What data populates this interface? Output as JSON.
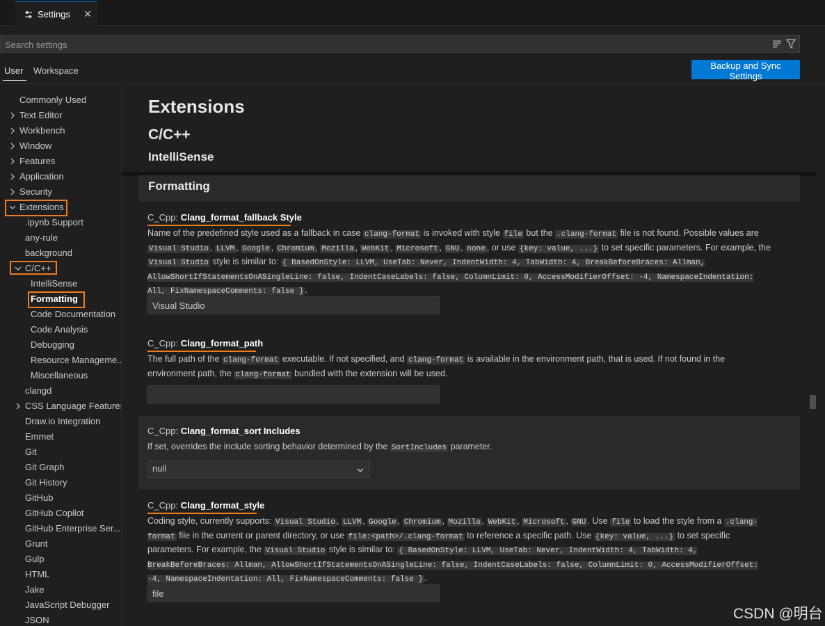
{
  "tab": {
    "icon": "settings-icon",
    "label": "Settings",
    "close": "✕"
  },
  "search": {
    "placeholder": "Search settings"
  },
  "scope": {
    "user": "User",
    "workspace": "Workspace",
    "backup_button": "Backup and Sync Settings"
  },
  "toc": [
    {
      "label": "Commonly Used",
      "indent": 0,
      "chevron": "none"
    },
    {
      "label": "Text Editor",
      "indent": 0,
      "chevron": "right"
    },
    {
      "label": "Workbench",
      "indent": 0,
      "chevron": "right"
    },
    {
      "label": "Window",
      "indent": 0,
      "chevron": "right"
    },
    {
      "label": "Features",
      "indent": 0,
      "chevron": "right"
    },
    {
      "label": "Application",
      "indent": 0,
      "chevron": "right"
    },
    {
      "label": "Security",
      "indent": 0,
      "chevron": "right"
    },
    {
      "label": "Extensions",
      "indent": 0,
      "chevron": "down",
      "highlight": true
    },
    {
      "label": ".ipynb Support",
      "indent": 1,
      "chevron": "none"
    },
    {
      "label": "any-rule",
      "indent": 1,
      "chevron": "none"
    },
    {
      "label": "background",
      "indent": 1,
      "chevron": "none"
    },
    {
      "label": "C/C++",
      "indent": 1,
      "chevron": "down",
      "highlight": true
    },
    {
      "label": "IntelliSense",
      "indent": 2,
      "chevron": "none"
    },
    {
      "label": "Formatting",
      "indent": 2,
      "chevron": "none",
      "highlight": true,
      "active": true
    },
    {
      "label": "Code Documentation",
      "indent": 2,
      "chevron": "none"
    },
    {
      "label": "Code Analysis",
      "indent": 2,
      "chevron": "none"
    },
    {
      "label": "Debugging",
      "indent": 2,
      "chevron": "none"
    },
    {
      "label": "Resource Manageme...",
      "indent": 2,
      "chevron": "none"
    },
    {
      "label": "Miscellaneous",
      "indent": 2,
      "chevron": "none"
    },
    {
      "label": "clangd",
      "indent": 1,
      "chevron": "none"
    },
    {
      "label": "CSS Language Features",
      "indent": 1,
      "chevron": "right"
    },
    {
      "label": "Draw.io Integration",
      "indent": 1,
      "chevron": "none"
    },
    {
      "label": "Emmet",
      "indent": 1,
      "chevron": "none"
    },
    {
      "label": "Git",
      "indent": 1,
      "chevron": "none"
    },
    {
      "label": "Git Graph",
      "indent": 1,
      "chevron": "none"
    },
    {
      "label": "Git History",
      "indent": 1,
      "chevron": "none"
    },
    {
      "label": "GitHub",
      "indent": 1,
      "chevron": "none"
    },
    {
      "label": "GitHub Copilot",
      "indent": 1,
      "chevron": "none"
    },
    {
      "label": "GitHub Enterprise Ser...",
      "indent": 1,
      "chevron": "none"
    },
    {
      "label": "Grunt",
      "indent": 1,
      "chevron": "none"
    },
    {
      "label": "Gulp",
      "indent": 1,
      "chevron": "none"
    },
    {
      "label": "HTML",
      "indent": 1,
      "chevron": "none"
    },
    {
      "label": "Jake",
      "indent": 1,
      "chevron": "none"
    },
    {
      "label": "JavaScript Debugger",
      "indent": 1,
      "chevron": "none"
    },
    {
      "label": "JSON",
      "indent": 1,
      "chevron": "none"
    }
  ],
  "main": {
    "h_extensions": "Extensions",
    "h_cpp": "C/C++",
    "h_intellisense": "IntelliSense",
    "h_formatting": "Formatting"
  },
  "settings": {
    "fallback": {
      "category": "C_Cpp: ",
      "key": "Clang_format_fallback Style",
      "desc": [
        {
          "t": "Name of the predefined style used as a fallback in case "
        },
        {
          "c": "clang-format"
        },
        {
          "t": " is invoked with style "
        },
        {
          "c": "file"
        },
        {
          "t": " but the "
        },
        {
          "c": ".clang-format"
        },
        {
          "t": " file is not found. Possible values are "
        },
        {
          "c": "Visual Studio"
        },
        {
          "t": ", "
        },
        {
          "c": "LLVM"
        },
        {
          "t": ", "
        },
        {
          "c": "Google"
        },
        {
          "t": ", "
        },
        {
          "c": "Chromium"
        },
        {
          "t": ", "
        },
        {
          "c": "Mozilla"
        },
        {
          "t": ", "
        },
        {
          "c": "WebKit"
        },
        {
          "t": ", "
        },
        {
          "c": "Microsoft"
        },
        {
          "t": ", "
        },
        {
          "c": "GNU"
        },
        {
          "t": ", "
        },
        {
          "c": "none"
        },
        {
          "t": ", or use "
        },
        {
          "c": "{key: value, ...}"
        },
        {
          "t": " to set specific parameters. For example, the "
        },
        {
          "c": "Visual Studio"
        },
        {
          "t": " style is similar to: "
        },
        {
          "c": "{ BasedOnStyle: LLVM, UseTab: Never, IndentWidth: 4, TabWidth: 4, BreakBeforeBraces: Allman, AllowShortIfStatementsOnASingleLine: false, IndentCaseLabels: false, ColumnLimit: 0, AccessModifierOffset: -4, NamespaceIndentation: All, FixNamespaceComments: false }"
        },
        {
          "t": "."
        }
      ],
      "value": "Visual Studio"
    },
    "path": {
      "category": "C_Cpp: ",
      "key": "Clang_format_path",
      "desc": [
        {
          "t": "The full path of the "
        },
        {
          "c": "clang-format"
        },
        {
          "t": " executable. If not specified, and "
        },
        {
          "c": "clang-format"
        },
        {
          "t": " is available in the environment path, that is used. If not found in the environment path, the "
        },
        {
          "c": "clang-format"
        },
        {
          "t": " bundled with the extension will be used."
        }
      ],
      "value": ""
    },
    "sort": {
      "category": "C_Cpp: ",
      "key": "Clang_format_sort Includes",
      "desc": [
        {
          "t": "If set, overrides the include sorting behavior determined by the "
        },
        {
          "c": "SortIncludes"
        },
        {
          "t": " parameter."
        }
      ],
      "value": "null"
    },
    "style": {
      "category": "C_Cpp: ",
      "key": "Clang_format_style",
      "desc": [
        {
          "t": "Coding style, currently supports: "
        },
        {
          "c": "Visual Studio"
        },
        {
          "t": ", "
        },
        {
          "c": "LLVM"
        },
        {
          "t": ", "
        },
        {
          "c": "Google"
        },
        {
          "t": ", "
        },
        {
          "c": "Chromium"
        },
        {
          "t": ", "
        },
        {
          "c": "Mozilla"
        },
        {
          "t": ", "
        },
        {
          "c": "WebKit"
        },
        {
          "t": ", "
        },
        {
          "c": "Microsoft"
        },
        {
          "t": ", "
        },
        {
          "c": "GNU"
        },
        {
          "t": ". Use "
        },
        {
          "c": "file"
        },
        {
          "t": " to load the style from a "
        },
        {
          "c": ".clang-format"
        },
        {
          "t": " file in the current or parent directory, or use "
        },
        {
          "c": "file:<path>/.clang-format"
        },
        {
          "t": " to reference a specific path. Use "
        },
        {
          "c": "{key: value, ...}"
        },
        {
          "t": " to set specific parameters. For example, the "
        },
        {
          "c": "Visual Studio"
        },
        {
          "t": " style is similar to: "
        },
        {
          "c": "{ BasedOnStyle: LLVM, UseTab: Never, IndentWidth: 4, TabWidth: 4, BreakBeforeBraces: Allman, AllowShortIfStatementsOnASingleLine: false, IndentCaseLabels: false, ColumnLimit: 0, AccessModifierOffset: -4, NamespaceIndentation: All, FixNamespaceComments: false }"
        },
        {
          "t": "."
        }
      ],
      "value": "file"
    }
  },
  "watermark": "CSDN @明台",
  "colors": {
    "accent": "#0078d4",
    "highlight": "#f07c1d",
    "background": "#1f1f1f"
  }
}
